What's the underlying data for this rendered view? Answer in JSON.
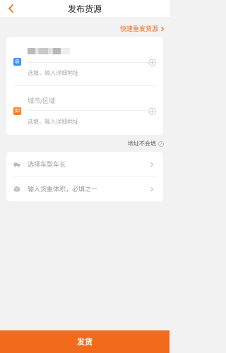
{
  "header": {
    "title": "发布货源",
    "back_icon": "back-chevron-icon"
  },
  "quick_reissue": {
    "label": "快速重发货源",
    "icon": "chevron-right-icon"
  },
  "loading": {
    "tag": "装",
    "detail_placeholder": "选填，输入详细地址",
    "color": "#3c8bff",
    "add_icon": "plus-circle-icon"
  },
  "unloading": {
    "tag": "卸",
    "city_placeholder": "城市/区域",
    "detail_placeholder": "选填，输入详细地址",
    "color": "#ff7a1a",
    "add_icon": "plus-circle-icon"
  },
  "address_note": {
    "text": "地址不会填",
    "icon": "question-circle-icon"
  },
  "options": [
    {
      "label": "选择车型车长",
      "icon": "truck-icon"
    },
    {
      "label": "输入货重体积，必填之一",
      "icon": "package-icon"
    }
  ],
  "submit": {
    "label": "发货",
    "color": "#f26a1b"
  }
}
